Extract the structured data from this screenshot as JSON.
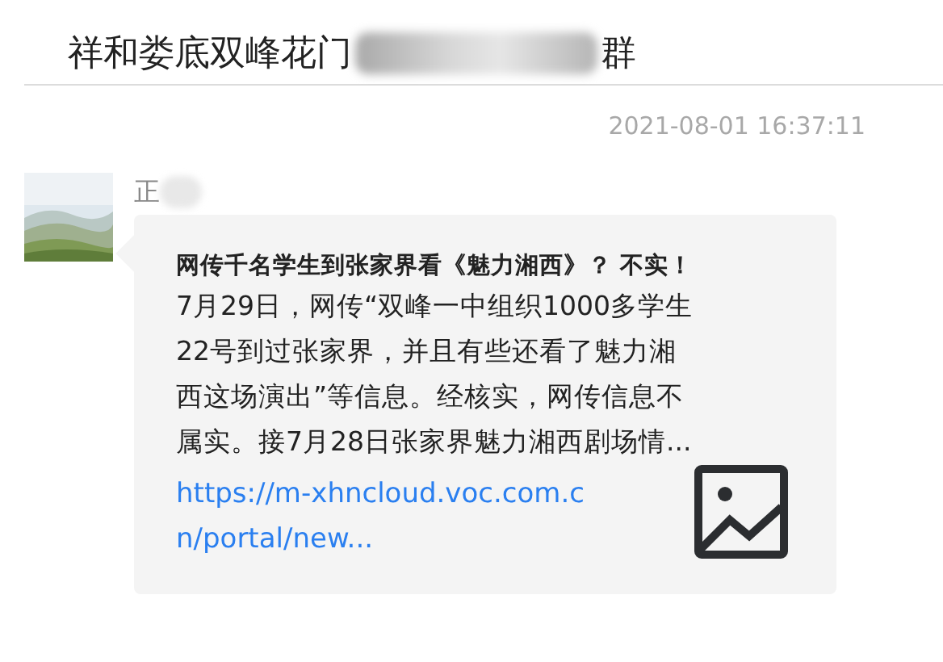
{
  "window": {
    "title_start": "祥和娄底双峰花门",
    "title_end": "群"
  },
  "timestamp": "2021-08-01 16:37:11",
  "message": {
    "sender": "正",
    "card": {
      "title": "网传千名学生到张家界看《魅力湘西》？ 不实！",
      "summary": "7月29日，网传“双峰一中组织1000多学生22号到过张家界，并且有些还看了魅力湘西这场演出”等信息。经核实，网传信息不属实。接7月28日张家界魅力湘西剧场情...",
      "link": "https://m-xhncloud.voc.com.cn/portal/new..."
    }
  }
}
